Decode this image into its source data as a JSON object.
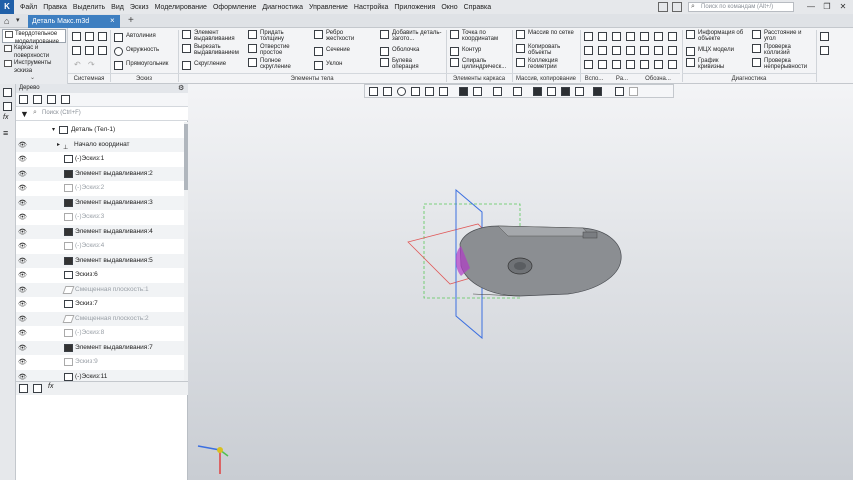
{
  "app": {
    "logo": "K"
  },
  "menu": [
    "Файл",
    "Правка",
    "Выделить",
    "Вид",
    "Эскиз",
    "Моделирование",
    "Оформление",
    "Диагностика",
    "Управление",
    "Настройка",
    "Приложения",
    "Окно",
    "Справка"
  ],
  "search": {
    "placeholder": "Поиск по командам (Alt+/)"
  },
  "tabs": {
    "document": "Деталь Макс.m3d",
    "close": "×"
  },
  "window": {
    "minimize": "—",
    "restore": "❐",
    "close": "✕"
  },
  "modes": [
    "Твердотельное моделирование",
    "Каркас и поверхности",
    "Инструменты эскиза"
  ],
  "ribbon": {
    "system": [
      "",
      "",
      ""
    ],
    "sketch": [
      "Автолиния",
      "Окружность",
      "Прямоугольник"
    ],
    "body1": [
      "Элемент выдавливания",
      "Вырезать выдавливанием",
      "Скругление"
    ],
    "body2": [
      "Придать толщину",
      "Отверстие простое",
      "Полное скругление"
    ],
    "body3": [
      "Ребро жесткости",
      "Сечение",
      "Уклон"
    ],
    "body4": [
      "Добавить деталь-загото...",
      "Оболочка",
      "Булева операция"
    ],
    "frame": [
      "Точка по координатам",
      "Контур",
      "Спираль цилиндрическ..."
    ],
    "array": [
      "Массив по сетке",
      "Копировать объекты",
      "Коллекция геометрии"
    ],
    "diag1": [
      "Информация об объекте",
      "МЦХ модели",
      "График кривизны"
    ],
    "diag2": [
      "Расстояние и угол",
      "Проверка коллизий",
      "Проверка непрерывности"
    ],
    "groups": [
      "Системная",
      "Эскиз",
      "Элементы тела",
      "Элементы каркаса",
      "Массив, копирование",
      "Вспо...",
      "Ра...",
      "Обозна...",
      "Диагностика"
    ]
  },
  "tree": {
    "title": "Дерево",
    "search_placeholder": "Поиск (Ctrl+F)",
    "items": [
      {
        "label": "Деталь (Тел-1)",
        "indent": 0,
        "eye": "",
        "dim": false
      },
      {
        "label": "Начало координат",
        "indent": 1,
        "eye": "👁",
        "dim": false
      },
      {
        "label": "(-)Эскиз:1",
        "indent": 1,
        "eye": "👁",
        "dim": false
      },
      {
        "label": "Элемент выдавливания:2",
        "indent": 1,
        "eye": "👁",
        "dim": false
      },
      {
        "label": "(-)Эскиз:2",
        "indent": 1,
        "eye": "👁",
        "dim": true
      },
      {
        "label": "Элемент выдавливания:3",
        "indent": 1,
        "eye": "👁",
        "dim": false
      },
      {
        "label": "(-)Эскиз:3",
        "indent": 1,
        "eye": "👁",
        "dim": true
      },
      {
        "label": "Элемент выдавливания:4",
        "indent": 1,
        "eye": "👁",
        "dim": false
      },
      {
        "label": "(-)Эскиз:4",
        "indent": 1,
        "eye": "👁",
        "dim": true
      },
      {
        "label": "Элемент выдавливания:5",
        "indent": 1,
        "eye": "👁",
        "dim": false
      },
      {
        "label": "Эскиз:6",
        "indent": 1,
        "eye": "👁",
        "dim": false
      },
      {
        "label": "Смещенная плоскость:1",
        "indent": 1,
        "eye": "👁",
        "dim": true
      },
      {
        "label": "Эскиз:7",
        "indent": 1,
        "eye": "👁",
        "dim": false
      },
      {
        "label": "Смещенная плоскость:2",
        "indent": 1,
        "eye": "👁",
        "dim": true
      },
      {
        "label": "(-)Эскиз:8",
        "indent": 1,
        "eye": "👁",
        "dim": true
      },
      {
        "label": "Элемент выдавливания:7",
        "indent": 1,
        "eye": "👁",
        "dim": false
      },
      {
        "label": "Эскиз:9",
        "indent": 1,
        "eye": "👁",
        "dim": true
      },
      {
        "label": "(-)Эскиз:11",
        "indent": 1,
        "eye": "👁",
        "dim": false
      }
    ],
    "footer_fx": "fx"
  },
  "left_fx": "fx",
  "colors": {
    "accent": "#3e7fc1",
    "model": "#8b8e92",
    "plane_blue": "#3b6fe0",
    "plane_green": "#5ac85a",
    "plane_red": "#e05a5a"
  }
}
